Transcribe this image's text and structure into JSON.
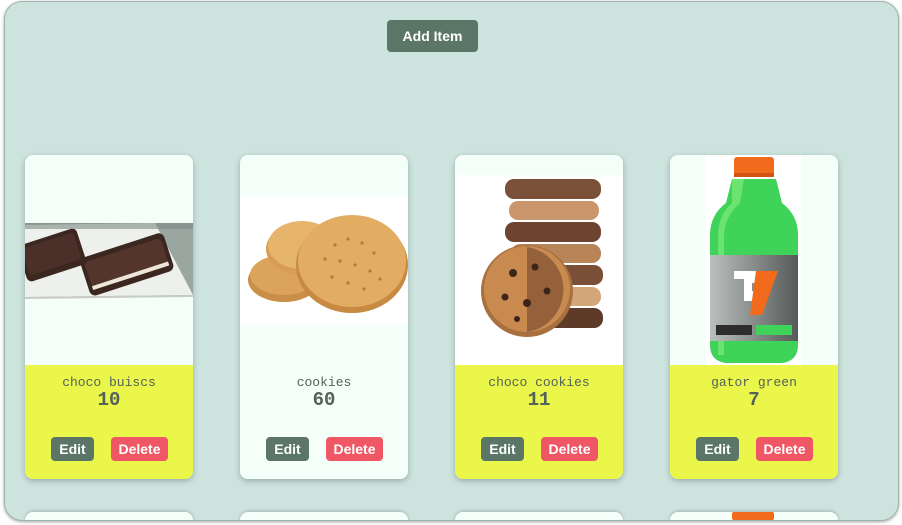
{
  "toolbar": {
    "add_label": "Add Item"
  },
  "items": [
    {
      "name": "choco buiscs",
      "quantity": "10",
      "edit_label": "Edit",
      "delete_label": "Delete",
      "image": "chocolate-biscuits-photo",
      "info_bg": "#eaf64a"
    },
    {
      "name": "cookies",
      "quantity": "60",
      "edit_label": "Edit",
      "delete_label": "Delete",
      "image": "digestive-cookies-photo",
      "info_bg": "#f5fff9"
    },
    {
      "name": "choco cookies",
      "quantity": "11",
      "edit_label": "Edit",
      "delete_label": "Delete",
      "image": "chocolate-chip-cookie-stack-photo",
      "info_bg": "#eaf64a"
    },
    {
      "name": "gator green",
      "quantity": "7",
      "edit_label": "Edit",
      "delete_label": "Delete",
      "image": "gatorade-bottle-photo",
      "info_bg": "#eaf64a"
    }
  ],
  "colors": {
    "background": "#cce3de",
    "primary": "#5b7666",
    "danger": "#ee5763",
    "highlight": "#eaf64a",
    "card": "#f5fff9"
  }
}
